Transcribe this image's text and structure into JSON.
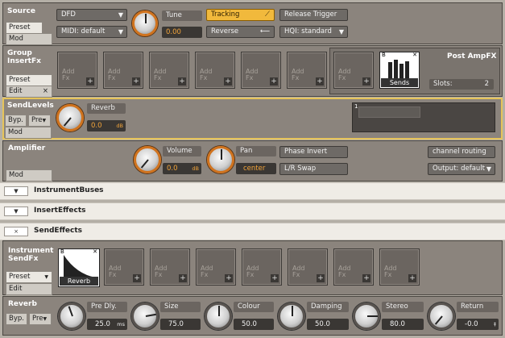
{
  "source": {
    "title": "Source",
    "preset": "Preset",
    "mod": "Mod",
    "dfd": "DFD",
    "midi": "MIDI: default",
    "tune_label": "Tune",
    "tune_value": "0.00",
    "tracking": "Tracking",
    "reverse": "Reverse",
    "release_trigger": "Release Trigger",
    "hqi": "HQI: standard"
  },
  "group_insert": {
    "title_l1": "Group",
    "title_l2": "InsertFx",
    "preset": "Preset",
    "edit": "Edit",
    "close": "×",
    "add_l1": "Add",
    "add_l2": "Fx",
    "plus": "+",
    "post_amp": "Post AmpFX",
    "sends_label": "Sends",
    "slots_label": "Slots:",
    "slots_value": "2"
  },
  "send_levels": {
    "title": "SendLevels",
    "byp": "Byp.",
    "pre": "Pre",
    "mod": "Mod",
    "reverb_label": "Reverb",
    "reverb_value": "0.0",
    "reverb_unit": "dB",
    "meter_index": "1"
  },
  "amplifier": {
    "title": "Amplifier",
    "mod": "Mod",
    "volume_label": "Volume",
    "volume_value": "0.0",
    "volume_unit": "dB",
    "pan_label": "Pan",
    "pan_value": "center",
    "phase_invert": "Phase Invert",
    "lr_swap": "L/R Swap",
    "channel_routing": "channel routing",
    "output": "Output: default"
  },
  "collapsed": {
    "instrument_buses": "InstrumentBuses",
    "insert_effects": "InsertEffects",
    "send_effects": "SendEffects",
    "arrow": "▼",
    "close": "×"
  },
  "instrument_send": {
    "title_l1": "Instrument",
    "title_l2": "SendFx",
    "preset": "Preset",
    "edit": "Edit",
    "reverb_fx": "Reverb"
  },
  "reverb": {
    "title": "Reverb",
    "byp": "Byp.",
    "pre": "Pre",
    "predly_label": "Pre Dly.",
    "predly_value": "25.0",
    "predly_unit": "ms",
    "size_label": "Size",
    "size_value": "75.0",
    "colour_label": "Colour",
    "colour_value": "50.0",
    "damping_label": "Damping",
    "damping_value": "50.0",
    "stereo_label": "Stereo",
    "stereo_value": "80.0",
    "return_label": "Return",
    "return_value": "-0.0",
    "return_unit": "‡"
  }
}
